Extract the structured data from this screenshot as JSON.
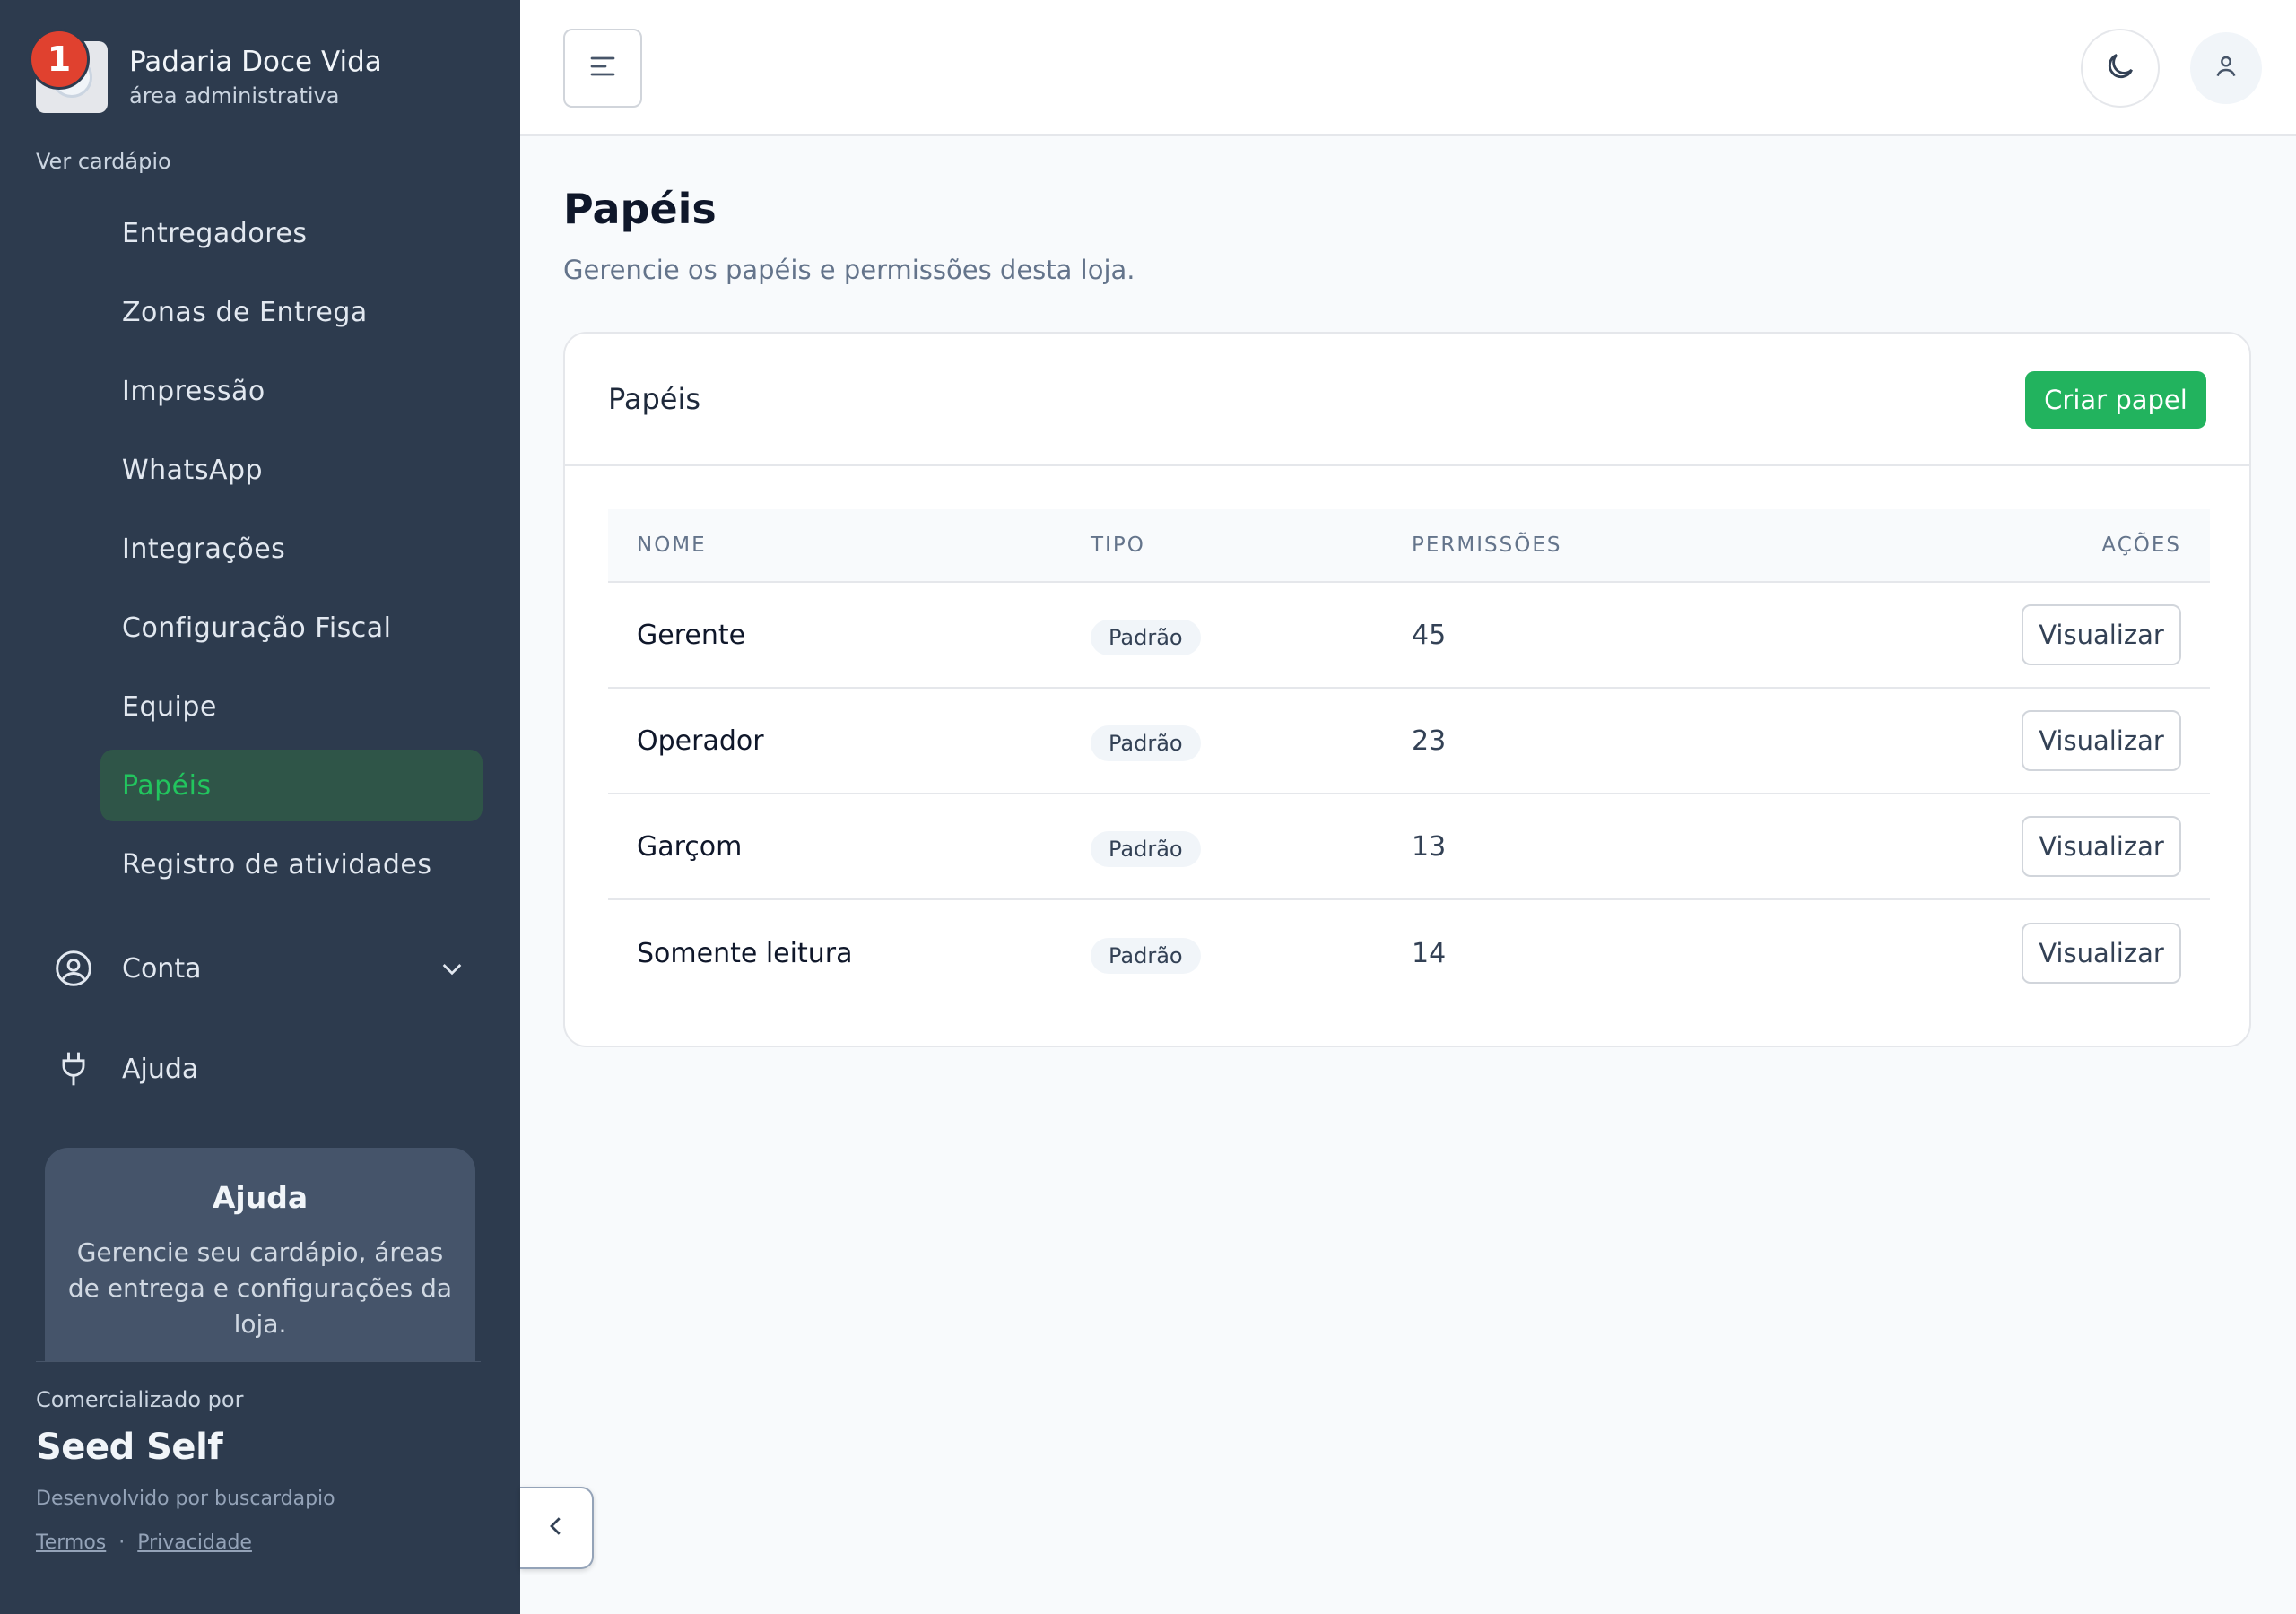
{
  "brand": {
    "name": "Padaria Doce Vida",
    "subtitle": "área administrativa",
    "notification_count": "1"
  },
  "sidebar": {
    "view_menu_label": "Ver cardápio",
    "items": [
      {
        "label": "Entregadores",
        "active": false
      },
      {
        "label": "Zonas de Entrega",
        "active": false
      },
      {
        "label": "Impressão",
        "active": false
      },
      {
        "label": "WhatsApp",
        "active": false
      },
      {
        "label": "Integrações",
        "active": false
      },
      {
        "label": "Configuração Fiscal",
        "active": false
      },
      {
        "label": "Equipe",
        "active": false
      },
      {
        "label": "Papéis",
        "active": true
      },
      {
        "label": "Registro de atividades",
        "active": false
      }
    ],
    "account_label": "Conta",
    "help_label": "Ajuda",
    "help_card": {
      "title": "Ajuda",
      "text": "Gerencie seu cardápio, áreas de entrega e configurações da loja."
    },
    "footer": {
      "sold_by": "Comercializado por",
      "brand": "Seed Self",
      "developed_by": "Desenvolvido por buscardapio",
      "terms": "Termos",
      "separator": "·",
      "privacy": "Privacidade"
    }
  },
  "page": {
    "title": "Papéis",
    "subtitle": "Gerencie os papéis e permissões desta loja."
  },
  "card": {
    "title": "Papéis",
    "create_button": "Criar papel",
    "columns": {
      "name": "NOME",
      "type": "TIPO",
      "permissions": "PERMISSÕES",
      "actions": "AÇÕES"
    },
    "rows": [
      {
        "name": "Gerente",
        "type": "Padrão",
        "permissions": "45",
        "action": "Visualizar"
      },
      {
        "name": "Operador",
        "type": "Padrão",
        "permissions": "23",
        "action": "Visualizar"
      },
      {
        "name": "Garçom",
        "type": "Padrão",
        "permissions": "13",
        "action": "Visualizar"
      },
      {
        "name": "Somente leitura",
        "type": "Padrão",
        "permissions": "14",
        "action": "Visualizar"
      }
    ]
  },
  "icons": {
    "menu": "menu-icon",
    "theme": "moon-icon",
    "user": "user-icon",
    "account": "user-circle-icon",
    "help": "plug-icon",
    "collapse": "chevron-left-icon"
  },
  "colors": {
    "sidebar_bg": "#2d3b4e",
    "accent": "#22b35e",
    "active_item_bg": "#2f5548",
    "badge": "#e0412f"
  }
}
